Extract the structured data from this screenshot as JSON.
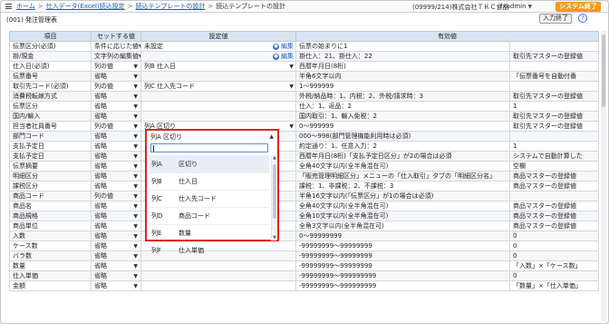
{
  "header": {
    "breadcrumb": [
      "ホーム",
      "仕入データ(Excel)読込設定",
      "読込テンプレートの設計",
      "読込テンプレートの設計"
    ],
    "breadcrumb_sep": ">",
    "company": "(09999/214)株式会社ＴＫＣ食品",
    "user": "fxadmin",
    "system_end": "システム終了"
  },
  "subheader": {
    "title": "(001) 発注管理表",
    "input_end": "入力終了",
    "help": "?"
  },
  "table": {
    "headers": [
      "項目",
      "セットする値",
      "設定値",
      "有効値"
    ],
    "edit_label": "編集",
    "rows": [
      {
        "item": "伝票区分(必須)",
        "set": "条件に応じた値",
        "setting": "未設定",
        "edit": true,
        "valid": "伝票の始まりに1",
        "valid2": ""
      },
      {
        "item": "掛/現金",
        "set": "文字列の編集値",
        "setting": "",
        "edit": true,
        "valid": "掛仕入：21、掛仕入：22",
        "valid2": "取引先マスターの登録値"
      },
      {
        "item": "仕入日(必須)",
        "set": "列の値",
        "setting": "列B 仕入日",
        "setting_select": true,
        "valid": "西暦年月日(8桁)",
        "valid2": ""
      },
      {
        "item": "伝票番号",
        "set": "省略",
        "setting": "",
        "valid": "半角6文字以内",
        "valid2": "「伝票番号を自動付番"
      },
      {
        "item": "取引先コード(必須)",
        "set": "列の値",
        "setting": "列C 仕入先コード",
        "setting_select": true,
        "valid": "1〜999999",
        "valid2": ""
      },
      {
        "item": "消費税転嫁方式",
        "set": "省略",
        "setting": "",
        "valid": "外税/納品時：1、内税：2、外税/請求時：3",
        "valid2": "取引先マスターの登録値"
      },
      {
        "item": "伝票区分",
        "set": "省略",
        "setting": "",
        "valid": "仕入：1、返品：2",
        "valid2": "1"
      },
      {
        "item": "国内/輸入",
        "set": "省略",
        "setting": "",
        "valid": "国内取引：1、輸入免税：2",
        "valid2": "取引先マスターの登録値"
      },
      {
        "item": "担当者社員番号",
        "set": "列の値",
        "setting": "列A 区切り",
        "setting_select": true,
        "valid": "0〜999999",
        "valid2": "取引先マスターの登録値"
      },
      {
        "item": "部門コード",
        "set": "省略",
        "setting": "",
        "valid": "000〜998(部門管理機能利用時は必須)",
        "valid2": ""
      },
      {
        "item": "支払予定日",
        "set": "省略",
        "setting": "",
        "valid": "約定通り：1、任意入力：2",
        "valid2": "1"
      },
      {
        "item": "支払予定日",
        "set": "省略",
        "setting": "",
        "valid": "西暦年月日(8桁)「支払予定日区分」が2の場合は必須",
        "valid2": "システムで自動計算した"
      },
      {
        "item": "伝票摘要",
        "set": "省略",
        "setting": "",
        "valid": "全角40文字以内(全半角混在可)",
        "valid2": "空欄"
      },
      {
        "item": "明細区分",
        "set": "省略",
        "setting": "",
        "valid": "「販売管理明細区分」メニューの「仕入取引」タブの「明細区分名」",
        "valid2": "商品マスターの登録値"
      },
      {
        "item": "課税区分",
        "set": "省略",
        "setting": "",
        "valid": "課税：1、非課税：2、不課税：3",
        "valid2": "商品マスターの登録値"
      },
      {
        "item": "商品コード",
        "set": "列の値",
        "setting": "",
        "valid": "半角16文字以内(「伝票区分」が1の場合は必須)",
        "valid2": ""
      },
      {
        "item": "商品名",
        "set": "省略",
        "setting": "",
        "valid": "全角40文字以内(全半角混在可)",
        "valid2": "商品マスターの登録値"
      },
      {
        "item": "商品規格",
        "set": "省略",
        "setting": "",
        "valid": "全角10文字以内(全半角混在可)",
        "valid2": "商品マスターの登録値"
      },
      {
        "item": "商品単位",
        "set": "省略",
        "setting": "",
        "valid": "全角3文字以内(全半角混在可)",
        "valid2": "商品マスターの登録値"
      },
      {
        "item": "入数",
        "set": "省略",
        "setting": "",
        "valid": "0〜99999999",
        "valid2": "0"
      },
      {
        "item": "ケース数",
        "set": "省略",
        "setting": "",
        "valid": "-99999999〜99999999",
        "valid2": "0"
      },
      {
        "item": "バラ数",
        "set": "省略",
        "setting": "",
        "valid": "-99999999〜99999999",
        "valid2": "0"
      },
      {
        "item": "数量",
        "set": "省略",
        "setting": "",
        "valid": "-99999999〜99999999",
        "valid2": "「入数」×「ケース数」"
      },
      {
        "item": "仕入単価",
        "set": "省略",
        "setting": "",
        "valid": "-99999999〜999999999",
        "valid2": "0"
      },
      {
        "item": "金額",
        "set": "省略",
        "setting": "",
        "valid": "-99999999〜999999999",
        "valid2": "「数量」×「仕入単価」"
      }
    ]
  },
  "dropdown": {
    "selected": "列A 区切り",
    "search_value": "",
    "options": [
      {
        "col": "列A",
        "label": "区切り"
      },
      {
        "col": "列B",
        "label": "仕入日"
      },
      {
        "col": "列C",
        "label": "仕入先コード"
      },
      {
        "col": "列D",
        "label": "商品コード"
      },
      {
        "col": "列E",
        "label": "数量"
      },
      {
        "col": "列F",
        "label": "仕入単価"
      }
    ]
  }
}
